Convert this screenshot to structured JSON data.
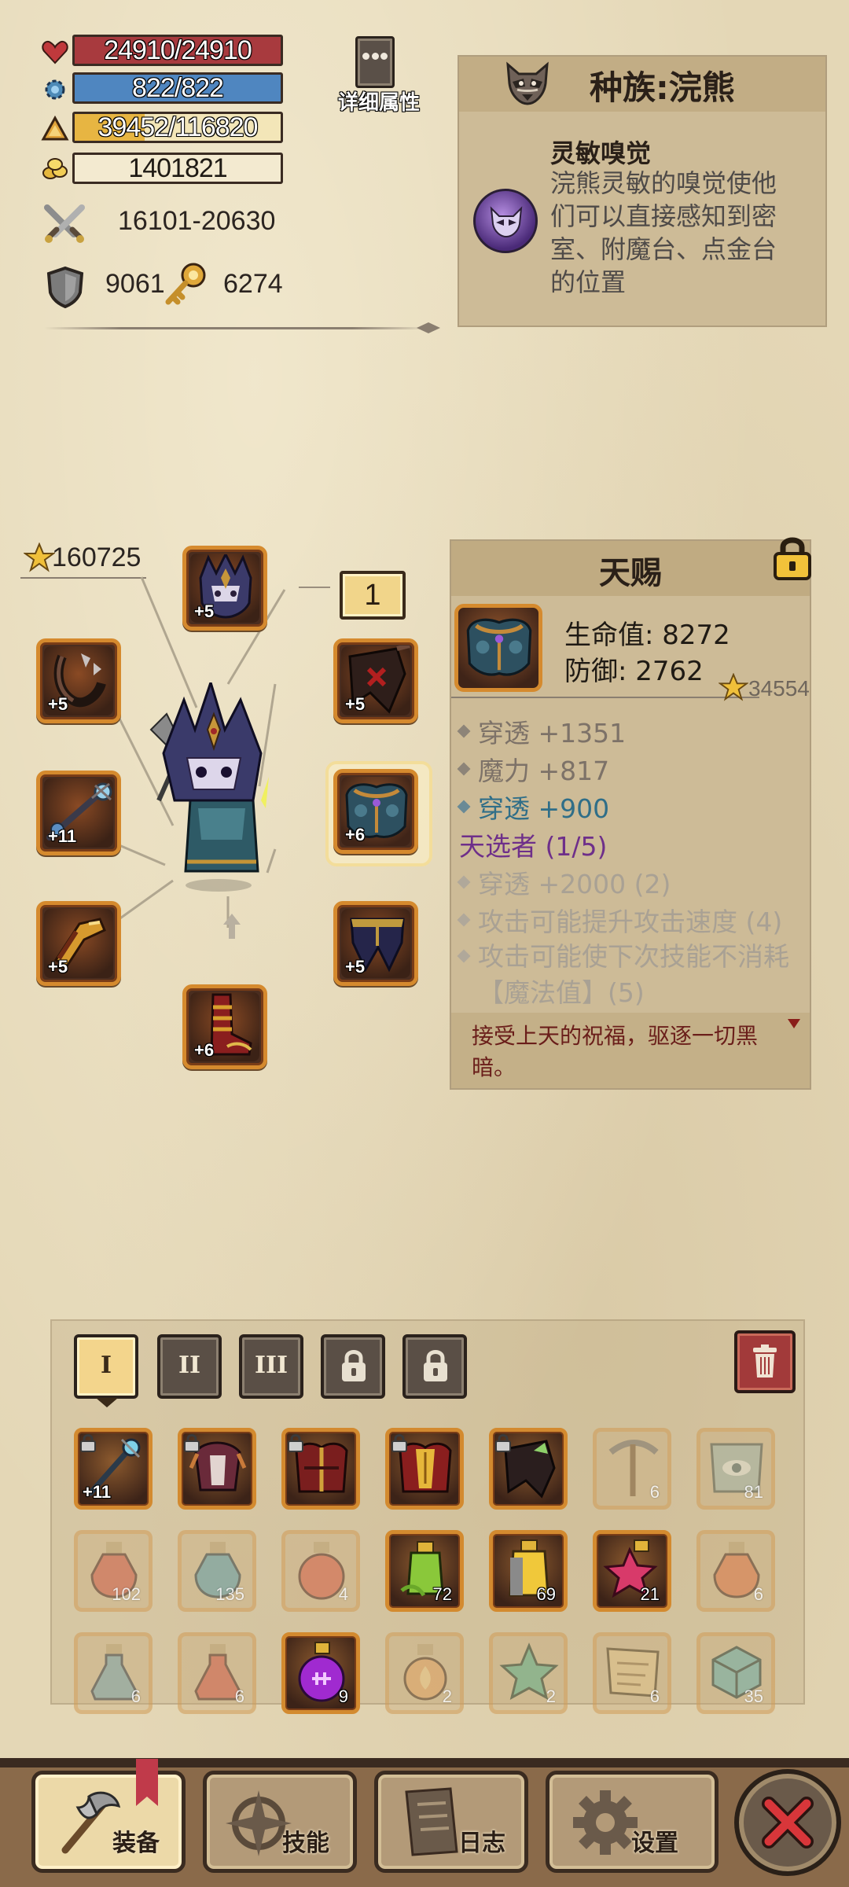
{
  "stats": {
    "hp": "24910/24910",
    "mp": "822/822",
    "xp": "39452/116820",
    "gold": "1401821",
    "attack": "16101-20630",
    "defense": "9061",
    "keys": "6274",
    "colors": {
      "hp": "#a83a3e",
      "mp": "#4f86c0",
      "xp": "#f3e6b8"
    }
  },
  "detail_button": {
    "label": "详细属性"
  },
  "race": {
    "title": "种族:浣熊",
    "trait_name": "灵敏嗅觉",
    "trait_desc": "浣熊灵敏的嗅觉使他们可以直接感知到密室、附魔台、点金台的位置"
  },
  "equipment": {
    "total_score": "160725",
    "set_marker": "1",
    "slots": [
      {
        "name": "helmet",
        "plus": "+5"
      },
      {
        "name": "necklace",
        "plus": "+5"
      },
      {
        "name": "weapon",
        "plus": "+11"
      },
      {
        "name": "ring",
        "plus": "+5"
      },
      {
        "name": "boots",
        "plus": "+6"
      },
      {
        "name": "cape",
        "plus": "+5"
      },
      {
        "name": "armor",
        "plus": "+6"
      },
      {
        "name": "legs",
        "plus": "+5"
      }
    ]
  },
  "item_detail": {
    "title": "天赐",
    "hp": "生命值: 8272",
    "def": "防御: 2762",
    "score": "34554",
    "attrs": [
      {
        "text": "穿透 +1351",
        "style": "gray"
      },
      {
        "text": "魔力 +817",
        "style": "gray"
      },
      {
        "text": "穿透 +900",
        "style": "blue"
      }
    ],
    "set_name": "天选者 (1/5)",
    "set_bonuses": [
      "穿透 +2000 (2)",
      "攻击可能提升攻击速度 (4)",
      "攻击可能使下次技能不消耗【魔法值】(5)"
    ],
    "flavor": "接受上天的祝福，驱逐一切黑暗。"
  },
  "inventory": {
    "tabs": [
      "I",
      "II",
      "III"
    ],
    "rows": [
      [
        {
          "name": "staff",
          "plus": "+11",
          "locked": true,
          "active": true
        },
        {
          "name": "gauntlet",
          "locked": true,
          "active": true
        },
        {
          "name": "red-armor",
          "locked": true,
          "active": true
        },
        {
          "name": "gold-red-armor",
          "locked": true,
          "active": true
        },
        {
          "name": "dark-cape",
          "locked": true,
          "active": true
        },
        {
          "name": "pickaxe",
          "count": "6",
          "active": false
        },
        {
          "name": "eye-scroll",
          "count": "81",
          "active": false
        }
      ],
      [
        {
          "name": "red-potion",
          "count": "102",
          "active": false
        },
        {
          "name": "blue-potion",
          "count": "135",
          "active": false
        },
        {
          "name": "big-red-potion",
          "count": "4",
          "active": false
        },
        {
          "name": "green-potion",
          "count": "72",
          "active": true
        },
        {
          "name": "yellow-potion",
          "count": "69",
          "active": true
        },
        {
          "name": "star-potion",
          "count": "21",
          "active": true
        },
        {
          "name": "orange-potion",
          "count": "6",
          "active": false
        }
      ],
      [
        {
          "name": "flask-blue",
          "count": "6",
          "active": false
        },
        {
          "name": "flask-red",
          "count": "6",
          "active": false
        },
        {
          "name": "purple-potion",
          "count": "9",
          "active": true
        },
        {
          "name": "fire-flask",
          "count": "2",
          "active": false
        },
        {
          "name": "star-green",
          "count": "2",
          "active": false
        },
        {
          "name": "map-scroll",
          "count": "6",
          "active": false
        },
        {
          "name": "cube",
          "count": "35",
          "active": false
        }
      ]
    ]
  },
  "nav": {
    "equip": "装备",
    "skills": "技能",
    "log": "日志",
    "settings": "设置"
  }
}
